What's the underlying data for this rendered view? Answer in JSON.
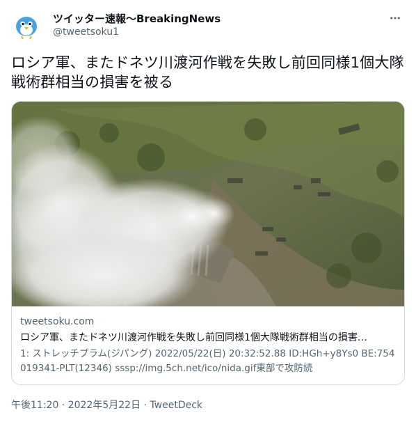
{
  "author": {
    "name": "ツイッター速報〜BreakingNews",
    "handle": "@tweetsoku1",
    "avatar_icon": "bird-mascot-icon",
    "accent": "#1d9bf0"
  },
  "tweet": {
    "text": "ロシア軍、またドネツ川渡河作戦を失敗し前回同様1個大隊戦術群相当の損害を被る"
  },
  "card": {
    "domain": "tweetsoku.com",
    "title": "ロシア軍、またドネツ川渡河作戦を失敗し前回同様1個大隊戦術群相当の損害…",
    "description": "1: ストレッチプラム(ジパング) 2022/05/22(日) 20:32:52.88 ID:HGh+y8Ys0 BE:754019341-PLT(12346) sssp://img.5ch.net/ico/nida.gif東部で攻防続"
  },
  "meta": {
    "time": "午後11:20",
    "separator1": " · ",
    "date": "2022年5月22日",
    "separator2": " · ",
    "source": "TweetDeck"
  }
}
